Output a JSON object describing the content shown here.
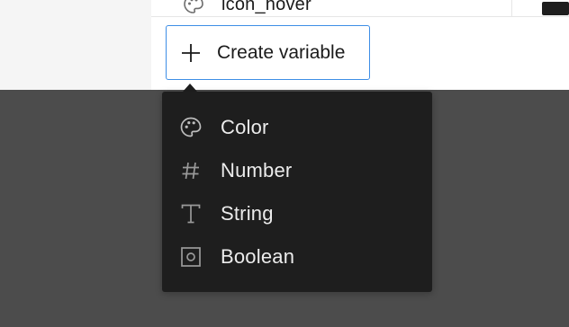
{
  "background_rows": {
    "partial_row_label": "icon_hover",
    "partial_row_icon": "palette-icon"
  },
  "create_button": {
    "label": "Create variable",
    "icon": "plus-icon",
    "border_color": "#3d8ee6"
  },
  "type_menu": {
    "items": [
      {
        "label": "Color",
        "icon": "palette-icon"
      },
      {
        "label": "Number",
        "icon": "hash-icon"
      },
      {
        "label": "String",
        "icon": "text-icon"
      },
      {
        "label": "Boolean",
        "icon": "boolean-icon"
      }
    ],
    "background": "#1e1e1e",
    "text_color": "#ececec"
  }
}
